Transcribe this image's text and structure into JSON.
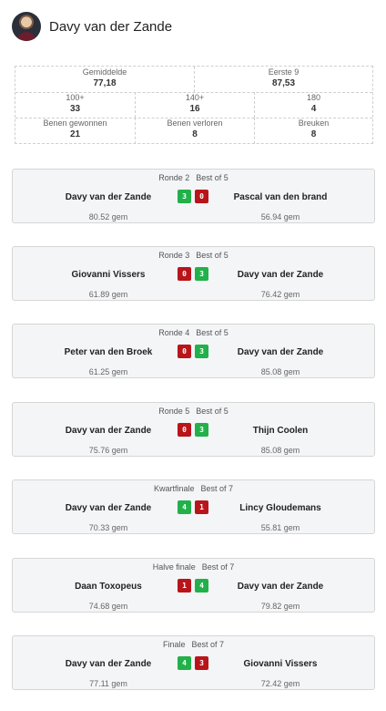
{
  "player": {
    "name": "Davy van der Zande"
  },
  "stats": {
    "row1": [
      {
        "label": "Gemiddelde",
        "value": "77,18"
      },
      {
        "label": "Eerste 9",
        "value": "87,53"
      }
    ],
    "row2": [
      {
        "label": "100+",
        "value": "33"
      },
      {
        "label": "140+",
        "value": "16"
      },
      {
        "label": "180",
        "value": "4"
      }
    ],
    "row3": [
      {
        "label": "Benen gewonnen",
        "value": "21"
      },
      {
        "label": "Benen verloren",
        "value": "8"
      },
      {
        "label": "Breuken",
        "value": "8"
      }
    ]
  },
  "colors": {
    "win": "#22b04a",
    "loss": "#b8151b"
  },
  "matches": [
    {
      "round": "Ronde 2",
      "format": "Best of 5",
      "left": "Davy van der Zande",
      "right": "Pascal van den brand",
      "score_left": "3",
      "score_right": "0",
      "avg_left": "80.52 gem",
      "avg_right": "56.94 gem"
    },
    {
      "round": "Ronde 3",
      "format": "Best of 5",
      "left": "Giovanni Vissers",
      "right": "Davy van der Zande",
      "score_left": "0",
      "score_right": "3",
      "avg_left": "61.89 gem",
      "avg_right": "76.42 gem"
    },
    {
      "round": "Ronde 4",
      "format": "Best of 5",
      "left": "Peter van den Broek",
      "right": "Davy van der Zande",
      "score_left": "0",
      "score_right": "3",
      "avg_left": "61.25 gem",
      "avg_right": "85.08 gem"
    },
    {
      "round": "Ronde 5",
      "format": "Best of 5",
      "left": "Davy van der Zande",
      "right": "Thijn Coolen",
      "score_left": "0",
      "score_right": "3",
      "avg_left": "75.76 gem",
      "avg_right": "85.08 gem"
    },
    {
      "round": "Kwartfinale",
      "format": "Best of 7",
      "left": "Davy van der Zande",
      "right": "Lincy Gloudemans",
      "score_left": "4",
      "score_right": "1",
      "avg_left": "70.33 gem",
      "avg_right": "55.81 gem"
    },
    {
      "round": "Halve finale",
      "format": "Best of 7",
      "left": "Daan Toxopeus",
      "right": "Davy van der Zande",
      "score_left": "1",
      "score_right": "4",
      "avg_left": "74.68 gem",
      "avg_right": "79.82 gem"
    },
    {
      "round": "Finale",
      "format": "Best of 7",
      "left": "Davy van der Zande",
      "right": "Giovanni Vissers",
      "score_left": "4",
      "score_right": "3",
      "avg_left": "77.11 gem",
      "avg_right": "72.42 gem"
    }
  ]
}
